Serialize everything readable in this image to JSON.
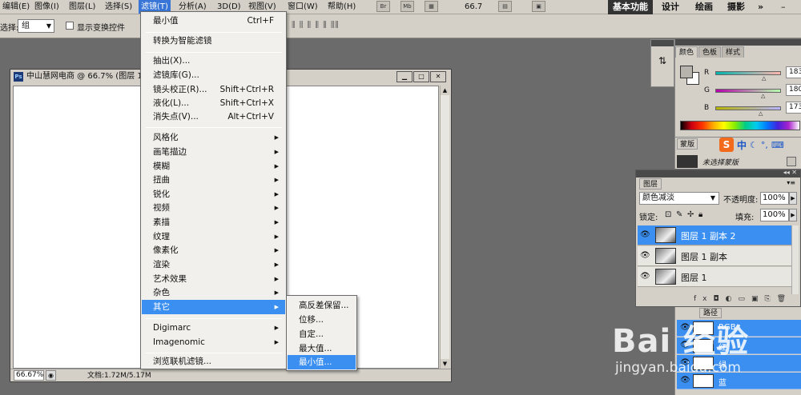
{
  "menubar": {
    "items": [
      "编辑(E)",
      "图像(I)",
      "图层(L)",
      "选择(S)",
      "滤镜(T)",
      "分析(A)",
      "3D(D)",
      "视图(V)",
      "窗口(W)",
      "帮助(H)"
    ],
    "toolbar_icons": [
      "Br",
      "Mb"
    ],
    "zoom": "66.7",
    "workspaces": [
      "基本功能",
      "设计",
      "绘画",
      "摄影"
    ],
    "active_workspace": "基本功能",
    "more": "»"
  },
  "optbar": {
    "select_label": "选择:",
    "select_value": "组",
    "show_transform": "显示变换控件"
  },
  "document": {
    "title": "中山慧网电商 @ 66.7% (图层 1",
    "zoom": "66.67%",
    "info": "文档:1.72M/5.17M"
  },
  "filter_menu": {
    "items": [
      {
        "label": "最小值",
        "shortcut": "Ctrl+F"
      },
      {
        "label": "转换为智能滤镜",
        "shortcut": ""
      },
      {
        "label": "抽出(X)...",
        "shortcut": ""
      },
      {
        "label": "滤镜库(G)...",
        "shortcut": ""
      },
      {
        "label": "镜头校正(R)...",
        "shortcut": "Shift+Ctrl+R"
      },
      {
        "label": "液化(L)...",
        "shortcut": "Shift+Ctrl+X"
      },
      {
        "label": "消失点(V)...",
        "shortcut": "Alt+Ctrl+V"
      },
      {
        "label": "风格化",
        "shortcut": ""
      },
      {
        "label": "画笔描边",
        "shortcut": ""
      },
      {
        "label": "模糊",
        "shortcut": ""
      },
      {
        "label": "扭曲",
        "shortcut": ""
      },
      {
        "label": "锐化",
        "shortcut": ""
      },
      {
        "label": "视频",
        "shortcut": ""
      },
      {
        "label": "素描",
        "shortcut": ""
      },
      {
        "label": "纹理",
        "shortcut": ""
      },
      {
        "label": "像素化",
        "shortcut": ""
      },
      {
        "label": "渲染",
        "shortcut": ""
      },
      {
        "label": "艺术效果",
        "shortcut": ""
      },
      {
        "label": "杂色",
        "shortcut": ""
      },
      {
        "label": "其它",
        "shortcut": ""
      },
      {
        "label": "Digimarc",
        "shortcut": ""
      },
      {
        "label": "Imagenomic",
        "shortcut": ""
      },
      {
        "label": "浏览联机滤镜...",
        "shortcut": ""
      }
    ],
    "highlighted": "其它"
  },
  "other_submenu": {
    "items": [
      "高反差保留...",
      "位移...",
      "自定...",
      "最大值...",
      "最小值..."
    ],
    "highlighted": "最小值..."
  },
  "color_panel": {
    "tabs": [
      "颜色",
      "色板",
      "样式"
    ],
    "channels": [
      {
        "name": "R",
        "value": "183"
      },
      {
        "name": "G",
        "value": "180"
      },
      {
        "name": "B",
        "value": "173"
      }
    ],
    "foreground": "#b7b4ad"
  },
  "mask_panel": {
    "tab": "蒙版",
    "text": "未选择蒙版",
    "ime": "中"
  },
  "layers_panel": {
    "tab": "图层",
    "blend_mode": "颜色减淡",
    "opacity_label": "不透明度:",
    "opacity": "100%",
    "lock_label": "锁定:",
    "fill_label": "填充:",
    "fill": "100%",
    "layers": [
      {
        "name": "图层 1 副本 2",
        "selected": true
      },
      {
        "name": "图层 1 副本",
        "selected": false
      },
      {
        "name": "图层 1",
        "selected": false
      }
    ]
  },
  "channels_panel": {
    "tab": "路径",
    "channels": [
      "RGB",
      "红",
      "绿",
      "蓝"
    ]
  },
  "watermark": {
    "logo": "Bai 经验",
    "url": "jingyan.baidu.com"
  }
}
